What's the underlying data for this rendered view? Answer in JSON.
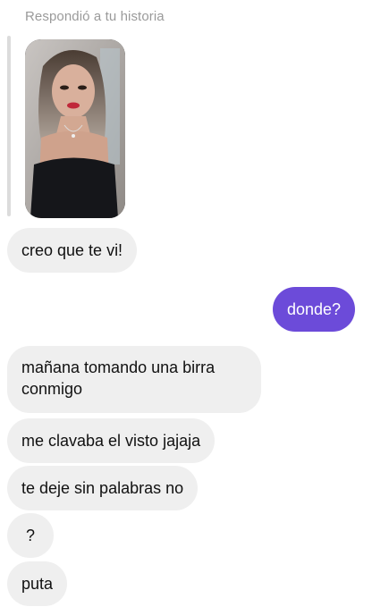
{
  "thread": {
    "reply_label": "Respondió a tu historia",
    "story_preview_alt": "story-photo"
  },
  "messages": [
    {
      "id": "m1",
      "from": "them",
      "text": "creo que te vi!"
    },
    {
      "id": "m2",
      "from": "me",
      "text": "donde?"
    },
    {
      "id": "m3",
      "from": "them",
      "text": "mañana tomando una birra conmigo"
    },
    {
      "id": "m4",
      "from": "them",
      "text": "me clavaba el visto jajaja"
    },
    {
      "id": "m5",
      "from": "them",
      "text": "te deje sin palabras no"
    },
    {
      "id": "m6",
      "from": "them",
      "text": "?"
    },
    {
      "id": "m7",
      "from": "them",
      "text": "puta"
    }
  ],
  "colors": {
    "sent_bubble": "#6c4bd9",
    "received_bubble": "#efefef"
  }
}
